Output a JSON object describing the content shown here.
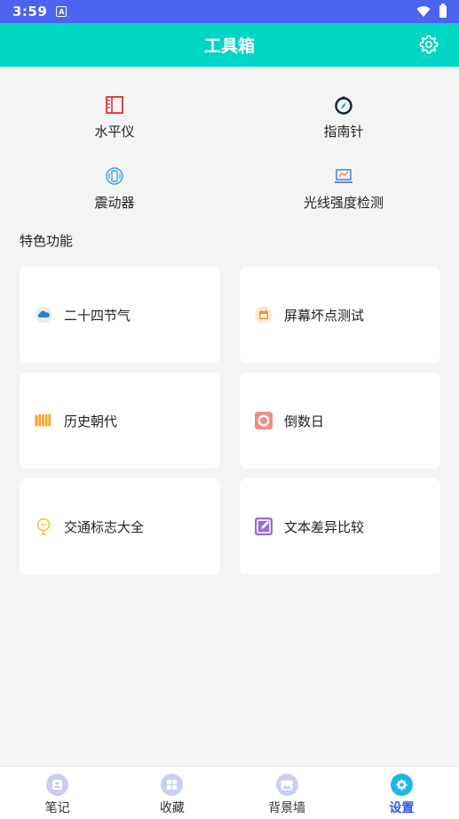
{
  "status_bar": {
    "time": "3:59",
    "notification_glyph": "A"
  },
  "app_bar": {
    "title": "工具箱",
    "settings_icon": "gear-icon"
  },
  "tools": [
    {
      "label": "水平仪",
      "icon": "ruler-icon"
    },
    {
      "label": "指南针",
      "icon": "compass-icon"
    },
    {
      "label": "震动器",
      "icon": "vibration-icon"
    },
    {
      "label": "光线强度检测",
      "icon": "light-sensor-icon"
    }
  ],
  "section": {
    "title": "特色功能"
  },
  "features": [
    {
      "label": "二十四节气",
      "icon": "cloud-icon"
    },
    {
      "label": "屏幕坏点测试",
      "icon": "calendar-icon"
    },
    {
      "label": "历史朝代",
      "icon": "bamboo-scroll-icon"
    },
    {
      "label": "倒数日",
      "icon": "countdown-icon"
    },
    {
      "label": "交通标志大全",
      "icon": "traffic-sign-icon"
    },
    {
      "label": "文本差异比较",
      "icon": "edit-icon"
    }
  ],
  "bottom_nav": [
    {
      "label": "笔记",
      "icon": "note-icon",
      "active": false
    },
    {
      "label": "收藏",
      "icon": "grid-icon",
      "active": false
    },
    {
      "label": "背景墙",
      "icon": "image-icon",
      "active": false
    },
    {
      "label": "设置",
      "icon": "gear-icon",
      "active": true
    }
  ],
  "colors": {
    "status_bar": "#4c63f0",
    "app_bar": "#00d6c4",
    "background": "#f4f4f4",
    "active_nav": "#2e5ae0"
  }
}
